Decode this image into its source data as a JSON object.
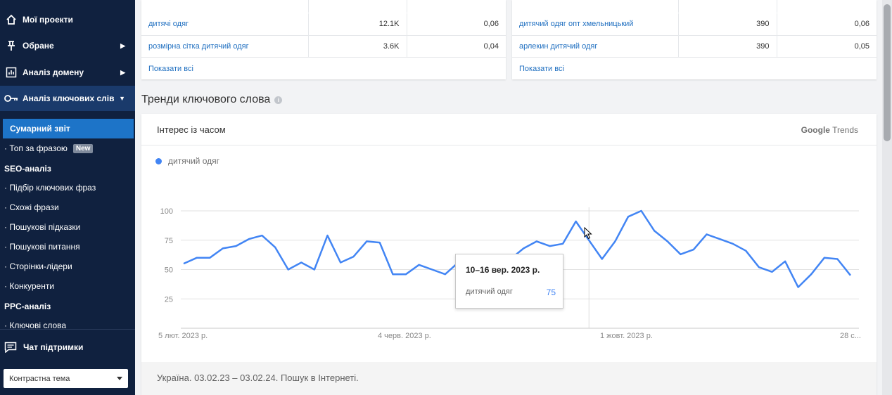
{
  "sidebar": {
    "items": [
      {
        "label": "Мої проекти",
        "icon": "home-icon"
      },
      {
        "label": "Обране",
        "icon": "pin-icon"
      },
      {
        "label": "Аналіз домену",
        "icon": "bar-chart-icon"
      },
      {
        "label": "Аналіз ключових слів",
        "icon": "key-icon"
      }
    ],
    "sub_selected": "Сумарний звіт",
    "sub_top": "· Топ за фразою",
    "new_badge": "New",
    "seo_label": "SEO-аналіз",
    "seo_items": [
      "· Підбір ключових фраз",
      "· Схожі фрази",
      "· Пошукові підказки",
      "· Пошукові питання",
      "· Сторінки-лідери",
      "· Конкуренти"
    ],
    "ppc_label": "PPC-аналіз",
    "ppc_items": [
      "· Ключові слова"
    ],
    "chat": "Чат підтримки",
    "theme": "Контрастна тема"
  },
  "tables": {
    "left": {
      "rows": [
        {
          "kw": "дитячі одяг",
          "vol": "12.1K",
          "cpc": "0,06"
        },
        {
          "kw": "розмірна сітка дитячий одяг",
          "vol": "3.6K",
          "cpc": "0,04"
        }
      ],
      "show_all": "Показати всі"
    },
    "right": {
      "rows": [
        {
          "kw": "дитячий одяг опт хмельницький",
          "vol": "390",
          "cpc": "0,06"
        },
        {
          "kw": "арлекин дитячий одяг",
          "vol": "390",
          "cpc": "0,05"
        }
      ],
      "show_all": "Показати всі"
    }
  },
  "trends": {
    "title": "Тренди ключового слова",
    "info": "i",
    "card_label": "Інтерес із часом",
    "logo_google": "Google",
    "logo_trends": "Trends",
    "footer": "Україна. 03.02.23 – 03.02.24. Пошук в Інтернеті.",
    "tooltip": {
      "date": "10–16 вер. 2023 р.",
      "series": "дитячий одяг",
      "value": "75"
    }
  },
  "colors": {
    "sidebar_bg": "#10213f",
    "accent": "#1d74c8",
    "line": "#4285f4",
    "link": "#1f6fc0"
  },
  "chart_data": {
    "type": "line",
    "title": "",
    "series": [
      {
        "name": "дитячий одяг",
        "values": [
          55,
          60,
          60,
          68,
          70,
          76,
          79,
          69,
          50,
          56,
          50,
          79,
          56,
          61,
          74,
          73,
          46,
          46,
          54,
          50,
          46,
          56,
          56,
          55,
          58,
          59,
          68,
          74,
          70,
          72,
          91,
          75,
          59,
          74,
          95,
          100,
          83,
          74,
          63,
          67,
          80,
          76,
          72,
          66,
          52,
          48,
          57,
          35,
          46,
          60,
          59,
          45
        ]
      }
    ],
    "x_tick_labels": [
      "5 лют. 2023 р.",
      "4 черв. 2023 р.",
      "1 жовт. 2023 р.",
      "28 с..."
    ],
    "y_ticks": [
      25,
      50,
      75,
      100
    ],
    "ylim": [
      0,
      100
    ],
    "grid": true,
    "legend": "top-left",
    "highlight_index": 31
  }
}
